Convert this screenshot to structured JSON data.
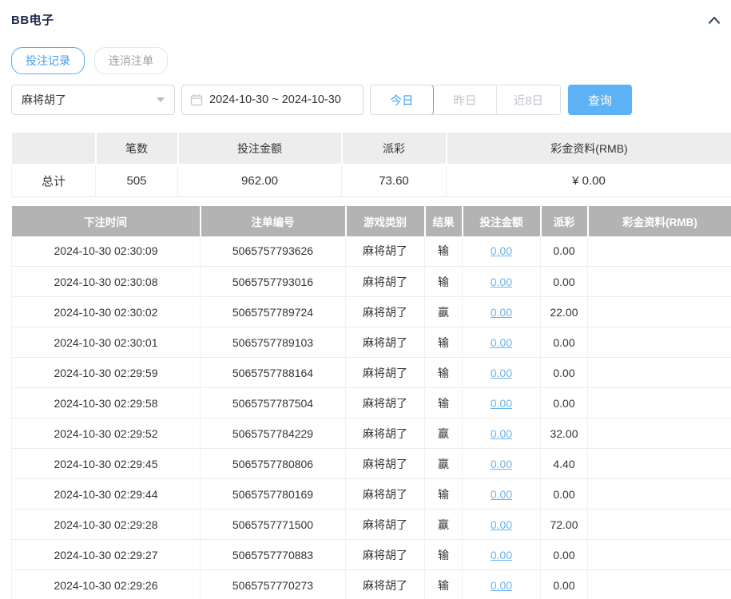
{
  "panel": {
    "title": "BB电子",
    "collapse_icon": "chevron-up-icon"
  },
  "tabs": [
    {
      "label": "投注记录",
      "active": true
    },
    {
      "label": "连消注单",
      "active": false
    }
  ],
  "filters": {
    "game_select": {
      "value": "麻将胡了",
      "icon": "chevron-down-icon"
    },
    "date_range": {
      "value": "2024-10-30 ~ 2024-10-30",
      "icon": "calendar-icon"
    },
    "quick_ranges": [
      {
        "label": "今日",
        "active": true
      },
      {
        "label": "昨日",
        "active": false
      },
      {
        "label": "近8日",
        "active": false
      }
    ],
    "search_label": "查询"
  },
  "summary_table": {
    "headers": [
      "",
      "笔数",
      "投注金额",
      "派彩",
      "彩金资料(RMB)"
    ],
    "row": {
      "label": "总计",
      "count": "505",
      "bet_amount": "962.00",
      "payout": "73.60",
      "jackpot": "¥ 0.00"
    }
  },
  "records_table": {
    "headers": [
      "下注时间",
      "注单编号",
      "游戏类别",
      "结果",
      "投注金额",
      "派彩",
      "彩金资料(RMB)"
    ],
    "rows": [
      {
        "time": "2024-10-30 02:30:09",
        "bet_id": "5065757793626",
        "game": "麻将胡了",
        "result": "输",
        "bet_amount": "0.00",
        "payout": "0.00",
        "jackpot": ""
      },
      {
        "time": "2024-10-30 02:30:08",
        "bet_id": "5065757793016",
        "game": "麻将胡了",
        "result": "输",
        "bet_amount": "0.00",
        "payout": "0.00",
        "jackpot": ""
      },
      {
        "time": "2024-10-30 02:30:02",
        "bet_id": "5065757789724",
        "game": "麻将胡了",
        "result": "赢",
        "bet_amount": "0.00",
        "payout": "22.00",
        "jackpot": ""
      },
      {
        "time": "2024-10-30 02:30:01",
        "bet_id": "5065757789103",
        "game": "麻将胡了",
        "result": "输",
        "bet_amount": "0.00",
        "payout": "0.00",
        "jackpot": ""
      },
      {
        "time": "2024-10-30 02:29:59",
        "bet_id": "5065757788164",
        "game": "麻将胡了",
        "result": "输",
        "bet_amount": "0.00",
        "payout": "0.00",
        "jackpot": ""
      },
      {
        "time": "2024-10-30 02:29:58",
        "bet_id": "5065757787504",
        "game": "麻将胡了",
        "result": "输",
        "bet_amount": "0.00",
        "payout": "0.00",
        "jackpot": ""
      },
      {
        "time": "2024-10-30 02:29:52",
        "bet_id": "5065757784229",
        "game": "麻将胡了",
        "result": "赢",
        "bet_amount": "0.00",
        "payout": "32.00",
        "jackpot": ""
      },
      {
        "time": "2024-10-30 02:29:45",
        "bet_id": "5065757780806",
        "game": "麻将胡了",
        "result": "赢",
        "bet_amount": "0.00",
        "payout": "4.40",
        "jackpot": ""
      },
      {
        "time": "2024-10-30 02:29:44",
        "bet_id": "5065757780169",
        "game": "麻将胡了",
        "result": "输",
        "bet_amount": "0.00",
        "payout": "0.00",
        "jackpot": ""
      },
      {
        "time": "2024-10-30 02:29:28",
        "bet_id": "5065757771500",
        "game": "麻将胡了",
        "result": "赢",
        "bet_amount": "0.00",
        "payout": "72.00",
        "jackpot": ""
      },
      {
        "time": "2024-10-30 02:29:27",
        "bet_id": "5065757770883",
        "game": "麻将胡了",
        "result": "输",
        "bet_amount": "0.00",
        "payout": "0.00",
        "jackpot": ""
      },
      {
        "time": "2024-10-30 02:29:26",
        "bet_id": "5065757770273",
        "game": "麻将胡了",
        "result": "输",
        "bet_amount": "0.00",
        "payout": "0.00",
        "jackpot": ""
      }
    ]
  },
  "colors": {
    "accent_blue": "#459df5",
    "search_button_blue": "#5db1f5",
    "link_blue": "#6ab3ea",
    "records_header_gray": "#b3b3b3",
    "summary_header_gray": "#ededed",
    "title_navy": "#1c2b4a"
  }
}
